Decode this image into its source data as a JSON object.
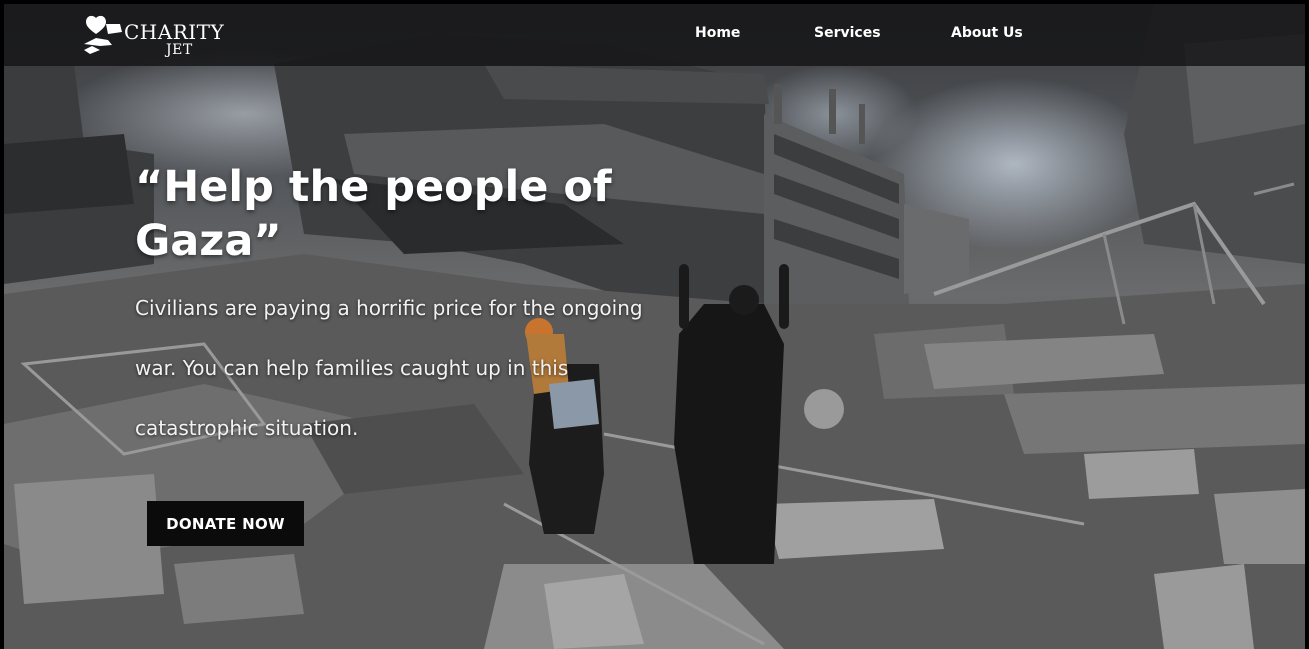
{
  "brand": {
    "name_line1": "CHARITY",
    "name_line2": "JET",
    "logo_icon": "hands-heart-icon"
  },
  "nav": {
    "items": [
      {
        "label": "Home"
      },
      {
        "label": "Services"
      },
      {
        "label": "About Us"
      }
    ]
  },
  "hero": {
    "title": "“Help the people of Gaza”",
    "description": "Civilians are paying a horrific price for the ongoing war. You can help families caught up in this catastrophic situation.",
    "cta_label": "DONATE NOW",
    "background_image": "destroyed-buildings-gaza-photo"
  },
  "colors": {
    "navbar": "#141416",
    "button": "#0b0b0b",
    "text": "#ffffff"
  }
}
